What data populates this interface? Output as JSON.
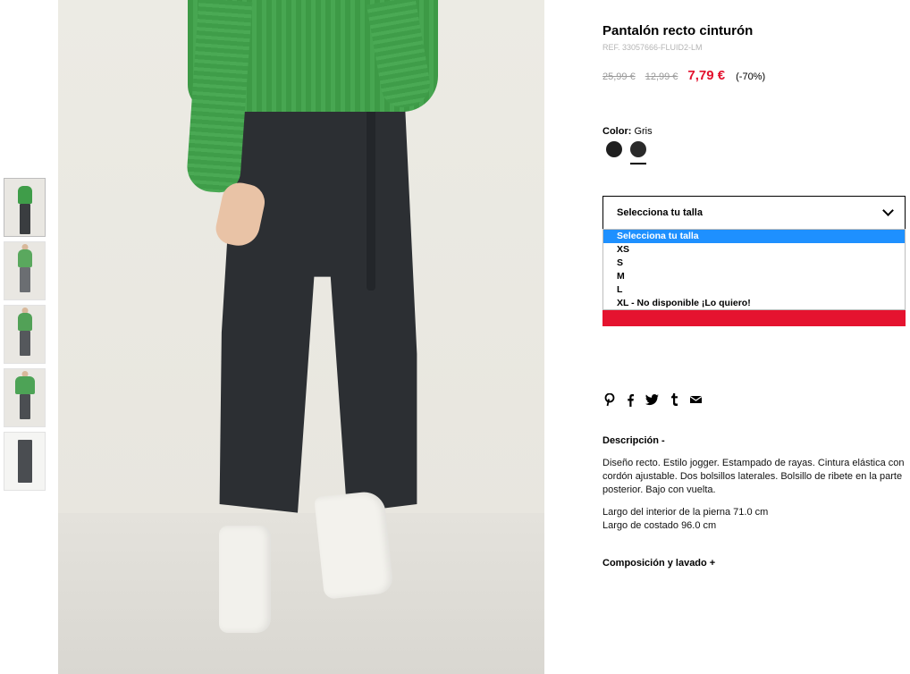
{
  "product": {
    "title": "Pantalón recto cinturón",
    "ref": "REF. 33057666-FLUID2-LM",
    "prices": {
      "original": "25,99 €",
      "previous": "12,99 €",
      "sale": "7,79 €",
      "discount": "(-70%)"
    },
    "color": {
      "label": "Color:",
      "value": "Gris",
      "swatches": [
        {
          "name": "swatch-1",
          "color": "#1f1f1f",
          "selected": false
        },
        {
          "name": "swatch-2",
          "color": "#2a2a2a",
          "selected": true
        }
      ]
    }
  },
  "size_select": {
    "current": "Selecciona tu talla",
    "options": [
      "Selecciona tu talla",
      "XS",
      "S",
      "M",
      "L",
      "XL - No disponible ¡Lo quiero!"
    ],
    "highlighted_index": 0
  },
  "share": {
    "icons": [
      "pinterest-icon",
      "facebook-icon",
      "twitter-icon",
      "tumblr-icon",
      "email-icon"
    ]
  },
  "description": {
    "heading": "Descripción -",
    "text": "Diseño recto. Estilo jogger. Estampado de rayas. Cintura elástica con cordón ajustable. Dos bolsillos laterales. Bolsillo de ribete en la parte posterior. Bajo con vuelta.",
    "measure_1": "Largo del interior de la pierna 71.0 cm",
    "measure_2": "Largo de costado 96.0 cm"
  },
  "composition": {
    "heading": "Composición y lavado +"
  },
  "colors": {
    "sale_red": "#e3102d",
    "highlight_blue": "#1e90ff",
    "cta_red": "#e5132f"
  }
}
